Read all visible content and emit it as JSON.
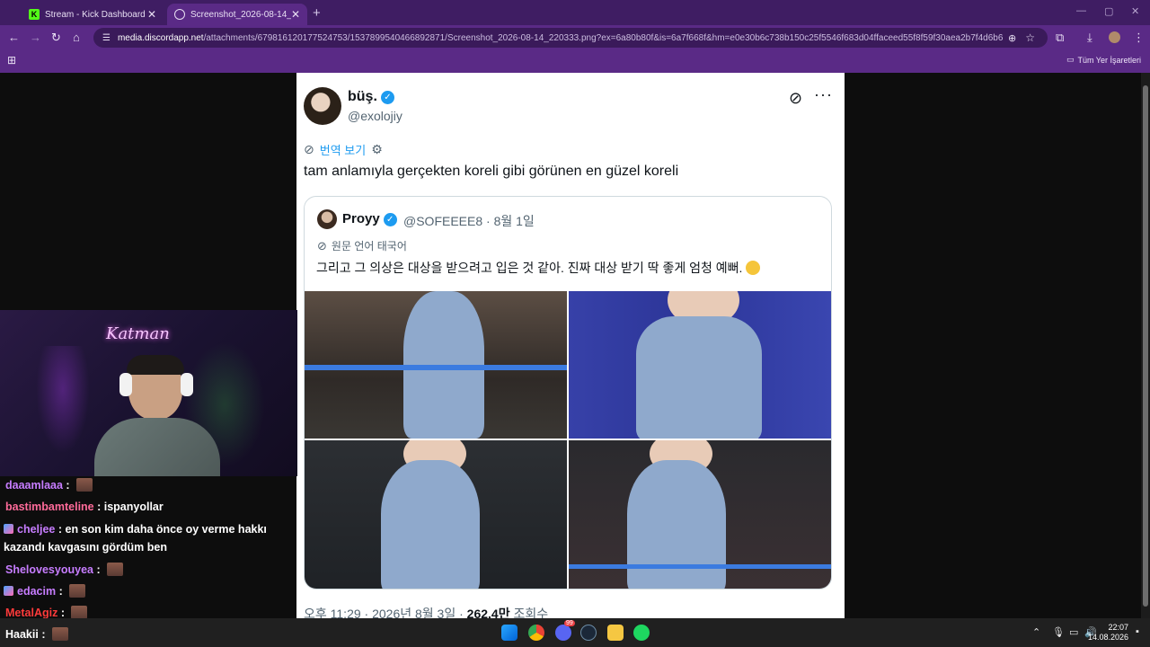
{
  "browser": {
    "tabs": [
      {
        "label": "Stream - Kick Dashboard",
        "favicon": "kick-icon",
        "color": "#53fc18"
      },
      {
        "label": "Screenshot_2026-08-14_220333",
        "favicon": "discord-icon",
        "color": "#ffffff"
      }
    ],
    "url_domain": "media.discordapp.net",
    "url_rest": "/attachments/679816120177524753/1537899540466892871/Screenshot_2026-08-14_220333.png?ex=6a80b80f&is=6a7f668f&hm=e0e30b6c738b150c25f5546f683d04ffaceed55f8f59f30aea2b7f4d6b6214fb&=&form...",
    "bookmarks_label": "Tüm Yer İşaretleri"
  },
  "tweet": {
    "display_name": "büş.",
    "handle": "@exolojiy",
    "translate_label": "번역 보기",
    "text": "tam anlamıyla gerçekten koreli gibi görünen en güzel koreli",
    "quote": {
      "display_name": "Proyy",
      "handle_date": "@SOFEEEE8 · 8월 1일",
      "orig_lang": "원문 언어 태국어",
      "text": "그리고 그 의상은 대상을 받으려고 입은 것 같아. 진짜 대상 받기 딱 좋게 엄청 예뻐."
    },
    "meta_time": "오후 11:29 · 2026년 8월 3일 · ",
    "meta_views": "262.4만",
    "meta_views_label": " 조회수"
  },
  "stream": {
    "neon_sign": "Katman"
  },
  "chat": [
    {
      "user": "daaamlaaa",
      "color": "#c77dff",
      "text": "",
      "emote": true,
      "badge": false
    },
    {
      "user": "bastimbamteline",
      "color": "#ff6b9a",
      "text": "ispanyollar",
      "emote": false,
      "badge": false
    },
    {
      "user": "cheljee",
      "color": "#c77dff",
      "text": "en son kim daha önce oy verme hakkı",
      "text2": "kazandı kavgasını gördüm ben",
      "emote": false,
      "badge": true
    },
    {
      "user": "Shelovesyouyea",
      "color": "#c77dff",
      "text": "",
      "emote": true,
      "badge": false
    },
    {
      "user": "edacim",
      "color": "#c77dff",
      "text": "",
      "emote": true,
      "badge": true
    },
    {
      "user": "MetalAgiz",
      "color": "#ff3b3b",
      "text": "",
      "emote": true,
      "badge": false
    },
    {
      "user": "Haakii",
      "color": "#ffffff",
      "text": "",
      "emote": true,
      "badge": false
    }
  ],
  "taskbar": {
    "time": "22:07",
    "date": "14.08.2026",
    "discord_badge": "99"
  }
}
